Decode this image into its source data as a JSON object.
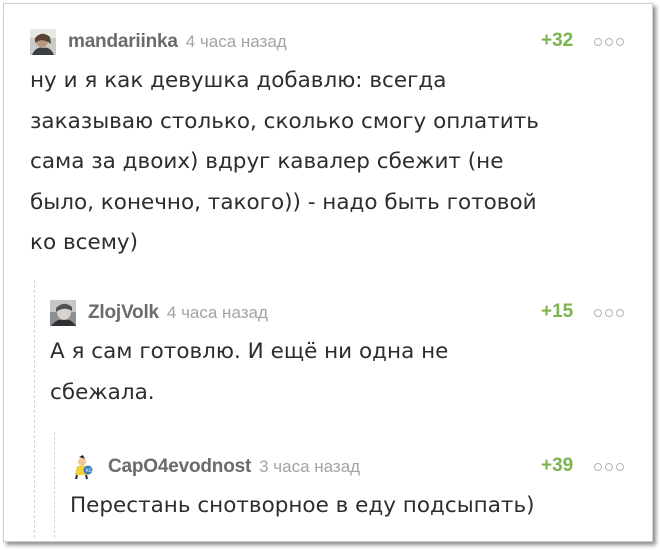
{
  "comments": [
    {
      "username": "mandariinka",
      "time": "4 часа назад",
      "score": "+32",
      "avatar_icon": "user-avatar-photo",
      "lines": [
        "ну и я как девушка добавлю: всегда",
        "заказываю столько, сколько смогу оплатить",
        "сама за двоих) вдруг кавалер сбежит (не",
        "было, конечно, такого)) - надо быть готовой",
        "ко всему)"
      ]
    },
    {
      "username": "ZlojVolk",
      "time": "4 часа назад",
      "score": "+15",
      "avatar_icon": "user-avatar-photo",
      "lines": [
        "А я сам готовлю. И ещё ни одна не",
        "сбежала."
      ]
    },
    {
      "username": "CapO4evodnost",
      "time": "3 часа назад",
      "score": "+39",
      "avatar_icon": "user-avatar-cartoon",
      "lines": [
        "Перестань снотворное в еду подсыпать)"
      ]
    }
  ],
  "colors": {
    "username": "#6b6b6b",
    "time": "#a3a3a3",
    "score": "#7db24e",
    "text": "#2d2d2d",
    "more_dots": "#b5b5b5"
  }
}
